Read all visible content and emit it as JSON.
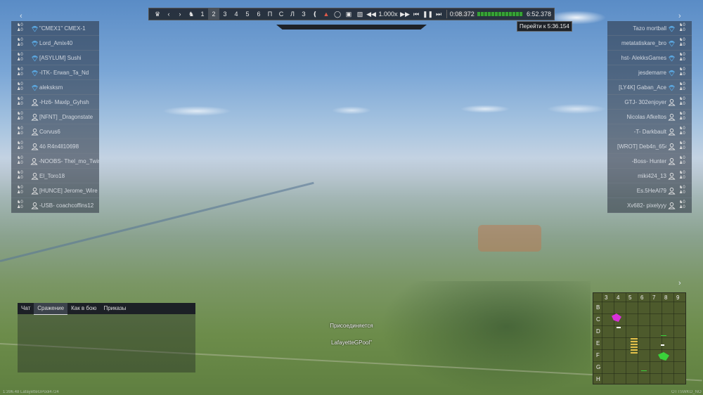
{
  "toolbar": {
    "buttons": [
      "1",
      "2",
      "3",
      "4",
      "5",
      "6",
      "П",
      "С",
      "Л",
      "З"
    ],
    "speed": "1.000x",
    "current_time": "0:08.372",
    "total_time": "6:52.378",
    "tooltip": "Перейти к 5:36.154",
    "progress": 0.92
  },
  "left_players": [
    {
      "name": "\"СМЕХ1\" СМЕХ-1",
      "icon": "parachute-icon"
    },
    {
      "name": "Lord_Amix40",
      "icon": "parachute-icon"
    },
    {
      "name": "[ASYLUM] Sushi",
      "icon": "parachute-icon"
    },
    {
      "name": "-ITK- Erwan_Ta_Nd",
      "icon": "parachute-icon"
    },
    {
      "name": "aleksksm",
      "icon": "parachute-icon"
    },
    {
      "name": "-Hz6- Maxlp_Gyhsh",
      "icon": "pilot-icon"
    },
    {
      "name": "[NFNT] _Dragonstate",
      "icon": "pilot-icon"
    },
    {
      "name": "Corvus6",
      "icon": "pilot-icon"
    },
    {
      "name": "4ö R4n4ll10698",
      "icon": "pilot-icon"
    },
    {
      "name": "-NOOBS- Thel_mo_Twin",
      "icon": "pilot-icon"
    },
    {
      "name": "El_Toro18",
      "icon": "pilot-icon"
    },
    {
      "name": "[HUNCE] Jerome_Wire",
      "icon": "pilot-icon"
    },
    {
      "name": "-USB- coachcoffins12",
      "icon": "pilot-icon"
    }
  ],
  "right_players": [
    {
      "name": "Tazo mortball",
      "icon": "parachute-icon"
    },
    {
      "name": "metatatiskare_bro",
      "icon": "parachute-icon"
    },
    {
      "name": "hst- AlekksGames",
      "icon": "parachute-icon"
    },
    {
      "name": "jesdemarre",
      "icon": "parachute-icon"
    },
    {
      "name": "[LY4K] Gaban_Ace",
      "icon": "parachute-icon"
    },
    {
      "name": "GTJ- 302enjoyer",
      "icon": "pilot-icon"
    },
    {
      "name": "Nicolas Afkeltos",
      "icon": "pilot-icon"
    },
    {
      "name": "-T- Darkbault",
      "icon": "pilot-icon"
    },
    {
      "name": "[WROT] Deb4n_6543",
      "icon": "pilot-icon"
    },
    {
      "name": "-Boss- Hunter",
      "icon": "pilot-icon"
    },
    {
      "name": "miki424_13",
      "icon": "pilot-icon"
    },
    {
      "name": "Es.5HeAl79",
      "icon": "pilot-icon"
    },
    {
      "name": "Xv682- pixelyyy",
      "icon": "pilot-icon"
    }
  ],
  "player_stat": "0",
  "chat": {
    "tabs": [
      "Чат",
      "Сражение",
      "Как в бою",
      "Приказы"
    ],
    "active_tab": "Сражение"
  },
  "center_messages": {
    "line1": "Присоединяется",
    "line2": "LafayetteGPool\""
  },
  "minimap": {
    "cols": [
      "3",
      "4",
      "5",
      "6",
      "7",
      "8",
      "9"
    ],
    "rows": [
      "B",
      "C",
      "D",
      "E",
      "F",
      "G",
      "H"
    ]
  },
  "bottom": {
    "left": "1:396.48    LafayetteGPool4724",
    "right": "OTTSWKO_NO"
  },
  "colors": {
    "progress_green": "#36a336",
    "toolbar_bg": "#1e2228"
  }
}
